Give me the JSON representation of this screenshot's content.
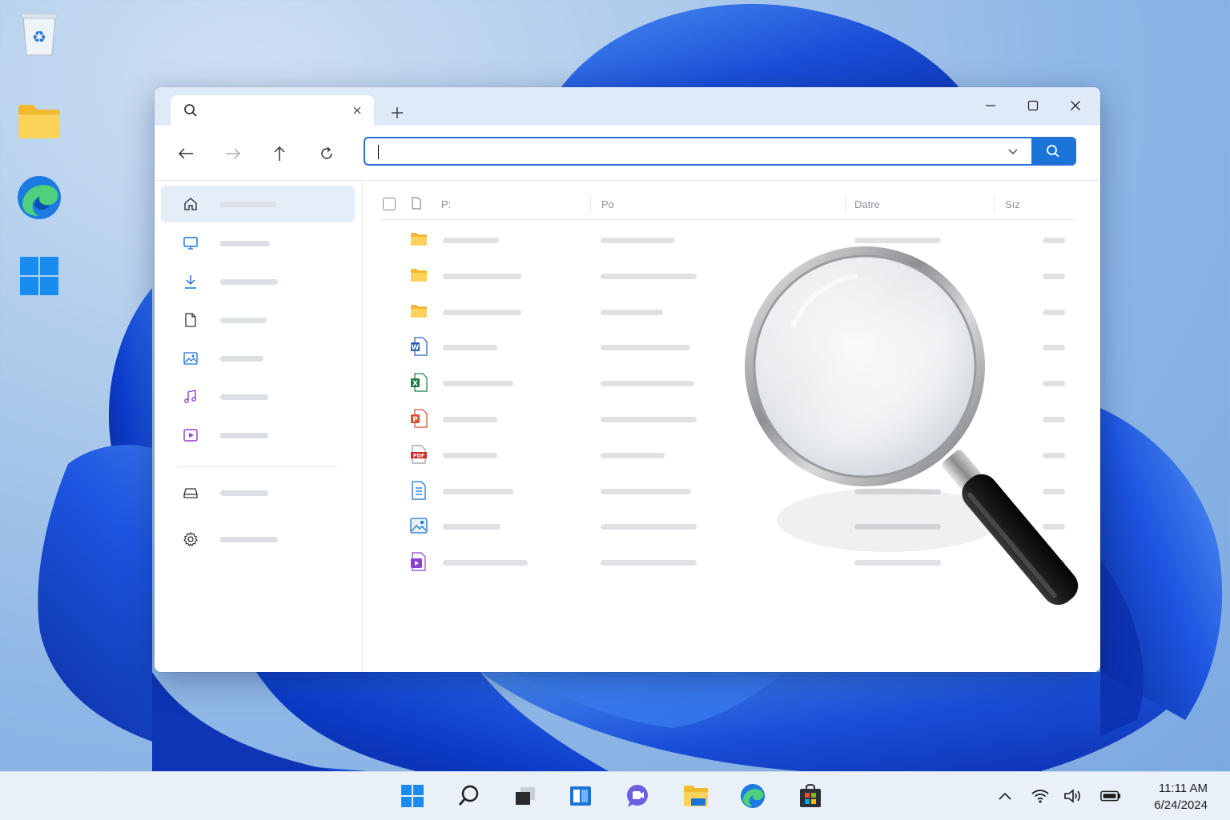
{
  "window": {
    "tab": {
      "label": ""
    },
    "search": {
      "value": "",
      "placeholder": ""
    }
  },
  "content": {
    "headers": {
      "name": "P:",
      "type": "Po",
      "date": "Datre",
      "size": "Sız"
    }
  },
  "taskbar": {
    "time": "11:11 AM",
    "date": "6/24/2024"
  },
  "colors": {
    "accent": "#1a73d6",
    "titlebar": "#dfeaf8",
    "selected": "#e4edf8",
    "folder": "#f5c543"
  }
}
